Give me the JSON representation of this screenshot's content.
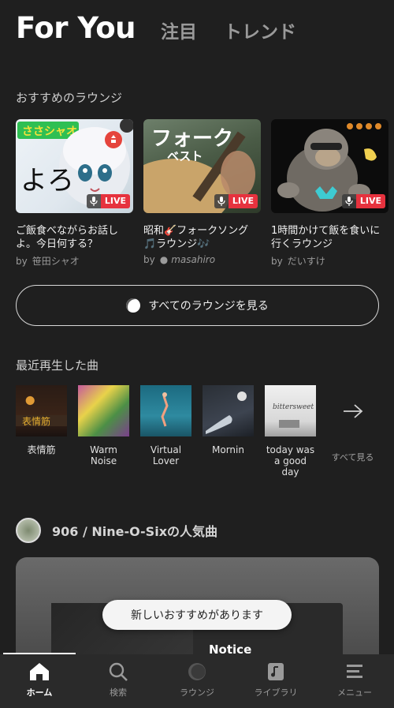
{
  "header": {
    "tabs": [
      {
        "label": "For You",
        "active": true
      },
      {
        "label": "注目",
        "active": false
      },
      {
        "label": "トレンド",
        "active": false
      }
    ]
  },
  "lounges": {
    "section_title": "おすすめのラウンジ",
    "live_label": "LIVE",
    "by_label": "by",
    "items": [
      {
        "title": "ご飯食べながらお話しよ。今日何する？",
        "host": "笹田シャオ",
        "thumb_text": "よろ"
      },
      {
        "title": "昭和🎸フォークソング🎵ラウンジ🎶",
        "host": "masahiro",
        "thumb_text": "フォーク",
        "thumb_sub": "ベスト"
      },
      {
        "title": "1時間かけて飯を食いに行くラウンジ",
        "host": "だいすけ",
        "thumb_text": ""
      }
    ],
    "see_all_button": "すべてのラウンジを見る"
  },
  "recent": {
    "section_title": "最近再生した曲",
    "items": [
      {
        "label": "表情筋"
      },
      {
        "label": "Warm Noise"
      },
      {
        "label": "Virtual Lover"
      },
      {
        "label": "Mornin"
      },
      {
        "label": "today was a good day"
      }
    ],
    "see_all": "すべて見る"
  },
  "artist_section": {
    "title": "906 / Nine-O-Sixの人気曲",
    "notice": "Notice"
  },
  "toast": {
    "text": "新しいおすすめがあります"
  },
  "bottom_nav": [
    {
      "label": "ホーム",
      "icon": "home-icon",
      "active": true
    },
    {
      "label": "検索",
      "icon": "search-icon",
      "active": false
    },
    {
      "label": "ラウンジ",
      "icon": "lounge-icon",
      "active": false
    },
    {
      "label": "ライブラリ",
      "icon": "library-icon",
      "active": false
    },
    {
      "label": "メニュー",
      "icon": "menu-icon",
      "active": false
    }
  ],
  "colors": {
    "background": "#1f1f1f",
    "live_red": "#e6323e",
    "nav_bg": "#2a2a2a"
  }
}
